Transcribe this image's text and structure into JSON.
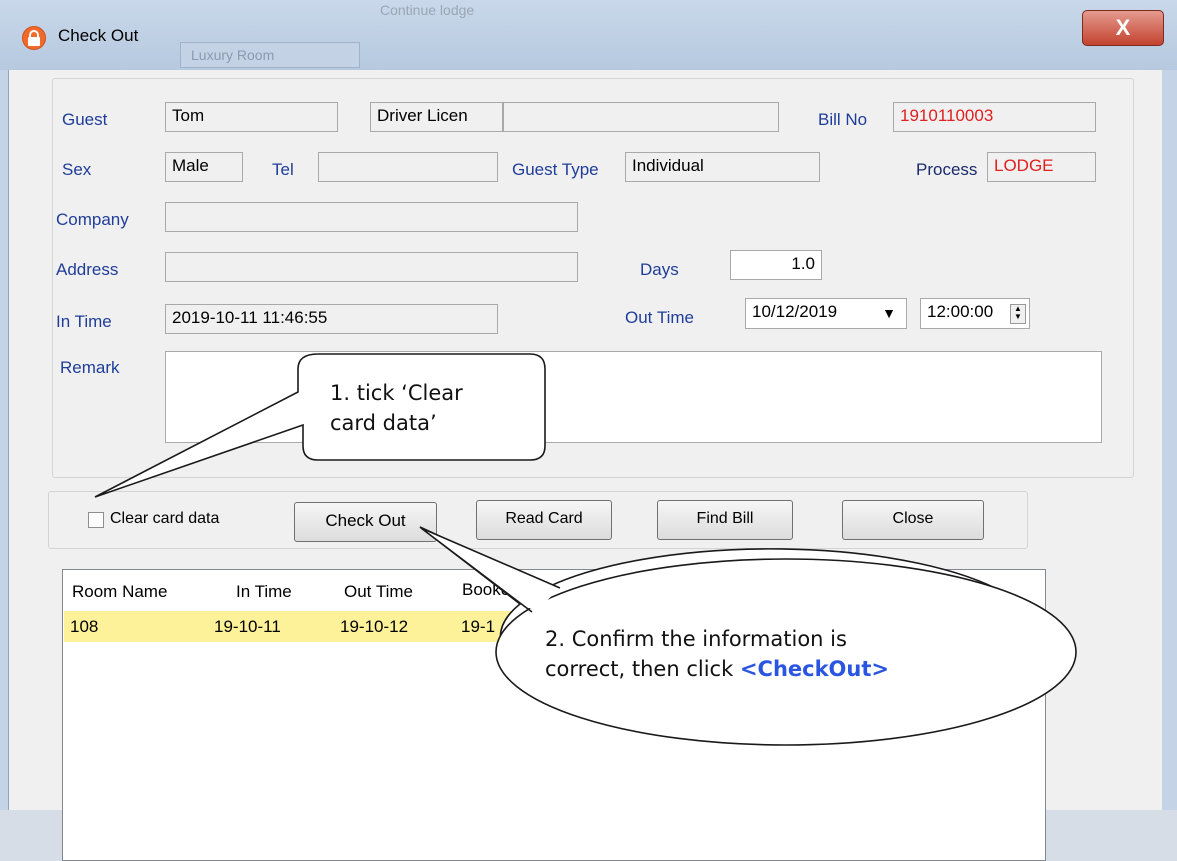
{
  "window": {
    "title": "Check Out",
    "close_glyph": "X",
    "background_tab": "Luxury Room",
    "background_menu": "Continue lodge"
  },
  "form": {
    "guest_label": "Guest",
    "guest_value": "Tom",
    "id_type_value": "Driver Licen",
    "id_number_value": "",
    "bill_no_label": "Bill No",
    "bill_no_value": "1910110003",
    "sex_label": "Sex",
    "sex_value": "Male",
    "tel_label": "Tel",
    "tel_value": "",
    "guest_type_label": "Guest Type",
    "guest_type_value": "Individual",
    "process_label": "Process",
    "process_value": "LODGE",
    "company_label": "Company",
    "company_value": "",
    "address_label": "Address",
    "address_value": "",
    "days_label": "Days",
    "days_value": "1.0",
    "in_time_label": "In Time",
    "in_time_value": "2019-10-11 11:46:55",
    "out_time_label": "Out Time",
    "out_date_value": "10/12/2019",
    "out_clock_value": "12:00:00",
    "remark_label": "Remark",
    "remark_value": ""
  },
  "actions": {
    "clear_card_label": "Clear card data",
    "clear_card_checked": false,
    "check_out": "Check Out",
    "read_card": "Read Card",
    "find_bill": "Find Bill",
    "close": "Close"
  },
  "rooms_table": {
    "columns": [
      "Room Name",
      "In Time",
      "Out Time",
      "Booker"
    ],
    "rows": [
      {
        "room_name": "108",
        "in_time": "19-10-11",
        "out_time": "19-10-12",
        "booker": "19-1"
      }
    ]
  },
  "callouts": {
    "step1_line1": "1. tick ‘Clear",
    "step1_line2": "card data’",
    "step2_line1": "2. Confirm the information is",
    "step2_line2_prefix": "correct, then click ",
    "step2_line2_link": "<CheckOut>"
  },
  "colors": {
    "label_blue": "#1f3d99",
    "value_red": "#e0201f",
    "selected_row": "#fdf29a",
    "callout_link": "#2a55e0"
  },
  "icons": [
    "lock-icon",
    "close-icon",
    "chevron-down-icon",
    "spinner-icon",
    "checkbox-icon"
  ]
}
